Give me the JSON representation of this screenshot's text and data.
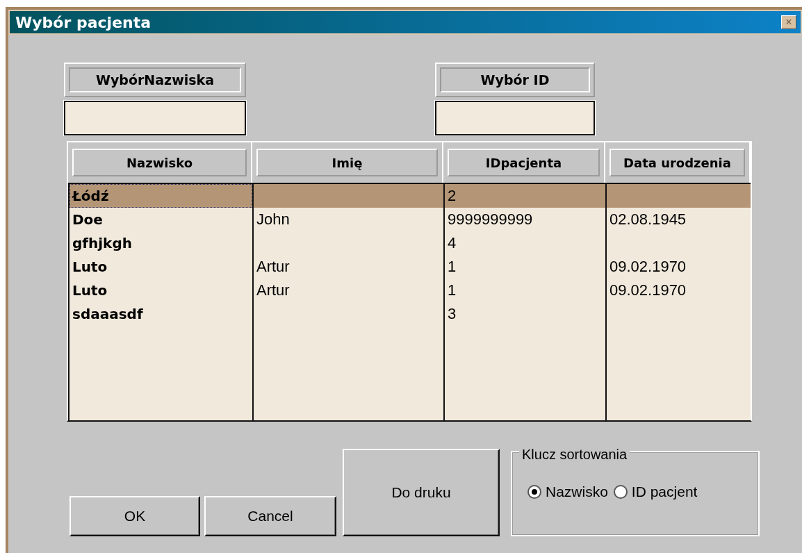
{
  "window": {
    "title": "Wybór pacjenta",
    "close": "×"
  },
  "filters": [
    {
      "label": "WybórNazwiska"
    },
    {
      "label": "Wybór ID"
    }
  ],
  "table": {
    "columns": [
      "Nazwisko",
      "Imię",
      "IDpacjenta",
      "Data urodzenia"
    ],
    "rows": [
      {
        "cells": [
          "Łódź",
          null,
          "2",
          null
        ],
        "selected": true
      },
      {
        "cells": [
          "Doe",
          "John",
          "9999999999",
          "02.08.1945"
        ],
        "selected": false
      },
      {
        "cells": [
          "gfhjkgh",
          null,
          "4",
          null
        ],
        "selected": false
      },
      {
        "cells": [
          "Luto",
          "Artur",
          "1",
          "09.02.1970"
        ],
        "selected": false
      },
      {
        "cells": [
          "Luto",
          "Artur",
          "1",
          "09.02.1970"
        ],
        "selected": false
      },
      {
        "cells": [
          "sdaaasdf",
          null,
          "3",
          null
        ],
        "selected": false
      }
    ]
  },
  "buttons": [
    {
      "label": "OK"
    },
    {
      "label": "Cancel"
    },
    {
      "label": "Do druku"
    }
  ],
  "sort_group": {
    "title": "Klucz sortowania",
    "options": [
      {
        "label": "Nazwisko",
        "selected": true
      },
      {
        "label": "ID pacjent",
        "selected": false
      }
    ]
  }
}
